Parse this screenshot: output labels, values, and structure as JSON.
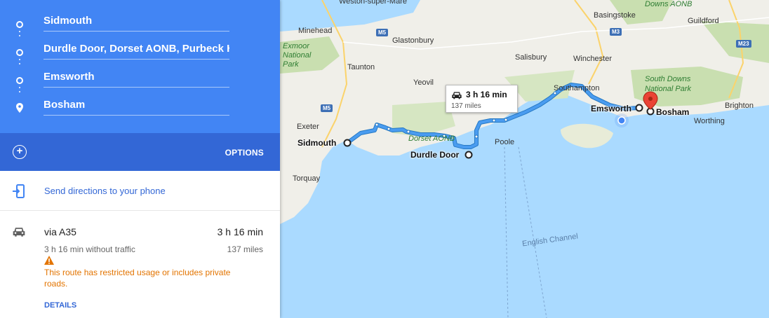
{
  "directions": {
    "stops": [
      {
        "label": "Sidmouth"
      },
      {
        "label": "Durdle Door, Dorset AONB, Purbeck Her"
      },
      {
        "label": "Emsworth"
      },
      {
        "label": "Bosham"
      }
    ],
    "options_label": "OPTIONS",
    "send_label": "Send directions to your phone",
    "route": {
      "via": "via A35",
      "duration": "3 h 16 min",
      "without_traffic": "3 h 16 min without traffic",
      "distance": "137 miles",
      "warning": "This route has restricted usage or includes private roads.",
      "details_label": "DETAILS"
    }
  },
  "map": {
    "towns": [
      "Weston-super-Mare",
      "Basingstoke",
      "Guildford",
      "Minehead",
      "Glastonbury",
      "Taunton",
      "Salisbury",
      "Yeovil",
      "Winchester",
      "Southampton",
      "Exeter",
      "Poole",
      "Torquay",
      "Brighton",
      "Worthing"
    ],
    "parks": [
      "Exmoor National Park",
      "Downs AONB",
      "South Downs National Park",
      "Dorset AONB"
    ],
    "sea_label": "English Channel",
    "road_shields": [
      "M5",
      "M5",
      "M3",
      "M23"
    ],
    "route_markers": [
      "Sidmouth",
      "Durdle Door",
      "Emsworth",
      "Bosham"
    ],
    "bubble": {
      "time": "3 h 16 min",
      "distance": "137 miles"
    },
    "colors": {
      "route": "#4a9cf0",
      "land": "#f0efe9",
      "forest": "#c9dfb0",
      "water": "#aadaff",
      "pin": "#ea4335"
    }
  }
}
